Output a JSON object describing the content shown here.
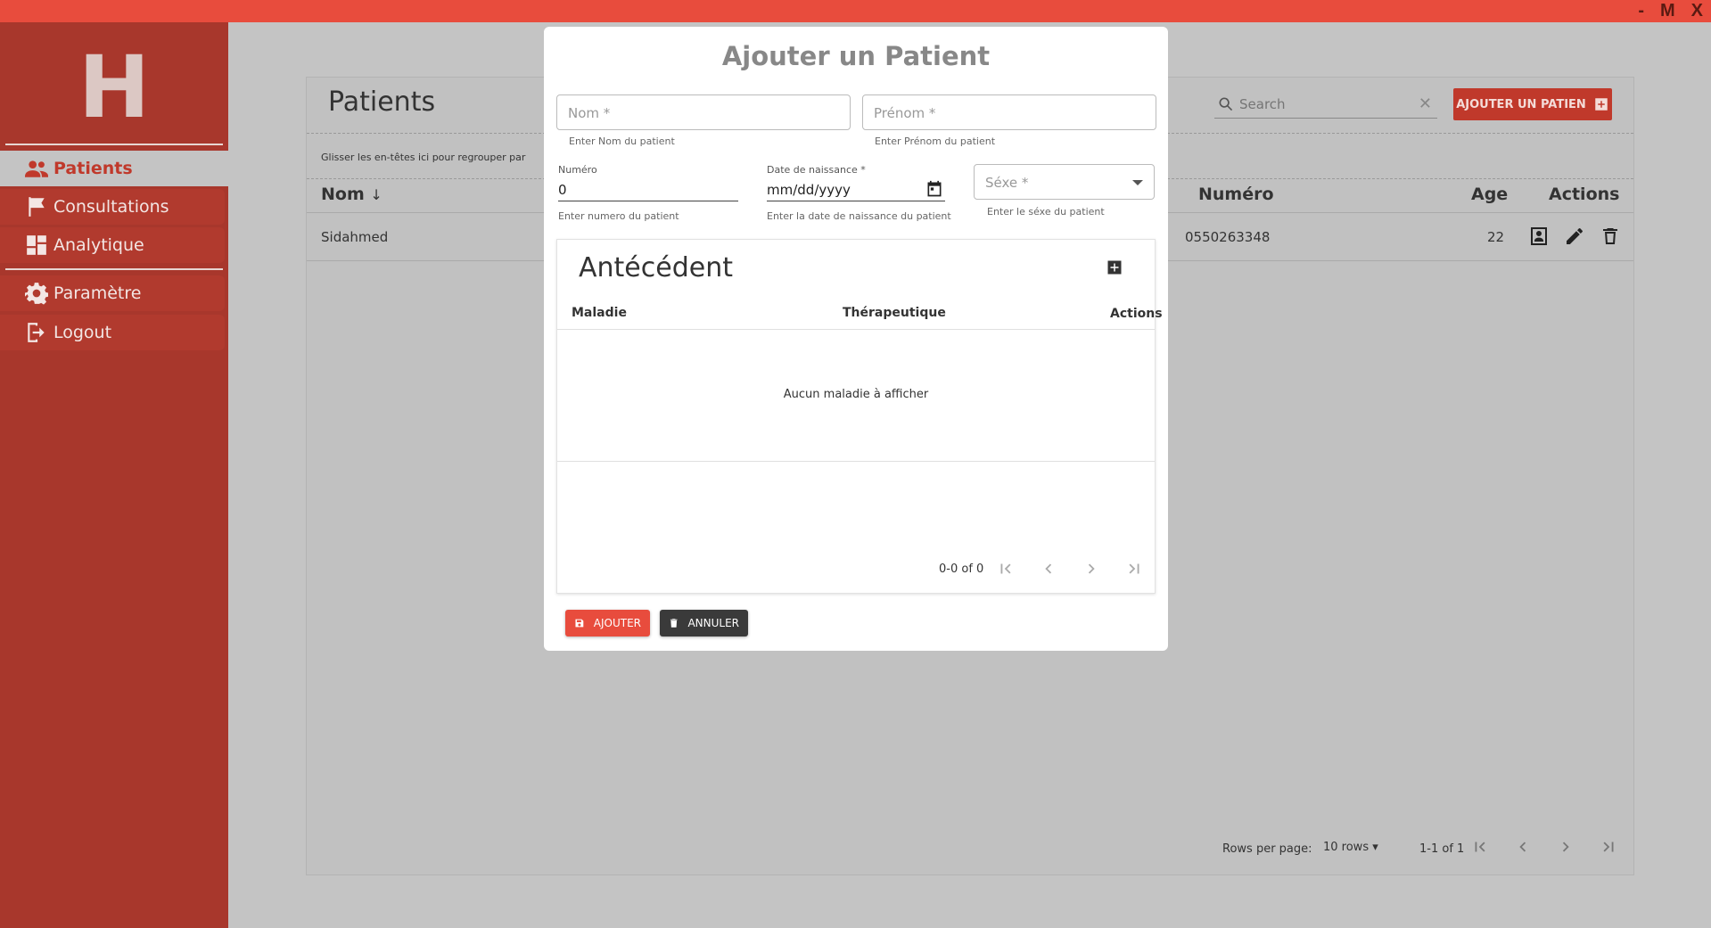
{
  "window": {
    "controls": [
      "-",
      "M",
      "X"
    ]
  },
  "sidebar": {
    "logo": "H",
    "items": [
      {
        "label": "Patients",
        "icon": "people-icon",
        "active": true
      },
      {
        "label": "Consultations",
        "icon": "flag-icon"
      },
      {
        "label": "Analytique",
        "icon": "dashboard-icon"
      },
      {
        "label": "Paramètre",
        "icon": "gear-icon"
      },
      {
        "label": "Logout",
        "icon": "logout-icon"
      }
    ]
  },
  "main": {
    "title": "Patients",
    "search_placeholder": "Search",
    "add_button": "AJOUTER UN PATIEN",
    "group_hint": "Glisser les en-têtes ici pour regrouper par",
    "columns": {
      "nom": "Nom",
      "numero": "Numéro",
      "age": "Age",
      "actions": "Actions"
    },
    "rows": [
      {
        "nom": "Sidahmed",
        "numero": "0550263348",
        "age": "22"
      }
    ],
    "footer": {
      "rows_per_page_label": "Rows per page:",
      "rows_per_page_value": "10 rows",
      "range": "1-1 of 1"
    }
  },
  "modal": {
    "title": "Ajouter un Patient",
    "nom": {
      "placeholder": "Nom *",
      "helper": "Enter Nom du patient"
    },
    "prenom": {
      "placeholder": "Prénom *",
      "helper": "Enter Prénom du patient"
    },
    "numero": {
      "label": "Numéro",
      "value": "0",
      "helper": "Enter numero du patient"
    },
    "date": {
      "label": "Date de naissance *",
      "value": "mm/dd/yyyy",
      "helper": "Enter la date de naissance du patient"
    },
    "sexe": {
      "placeholder": "Séxe *",
      "helper": "Enter le séxe du patient"
    },
    "antecedent": {
      "title": "Antécédent",
      "columns": {
        "maladie": "Maladie",
        "therapeutique": "Thérapeutique",
        "actions": "Actions"
      },
      "empty": "Aucun maladie à afficher",
      "range": "0-0 of 0"
    },
    "buttons": {
      "save": "AJOUTER",
      "cancel": "ANNULER"
    }
  },
  "colors": {
    "accent": "#e84c3d",
    "sidebar": "#a8372c",
    "overlay": "#c4c4c4"
  }
}
